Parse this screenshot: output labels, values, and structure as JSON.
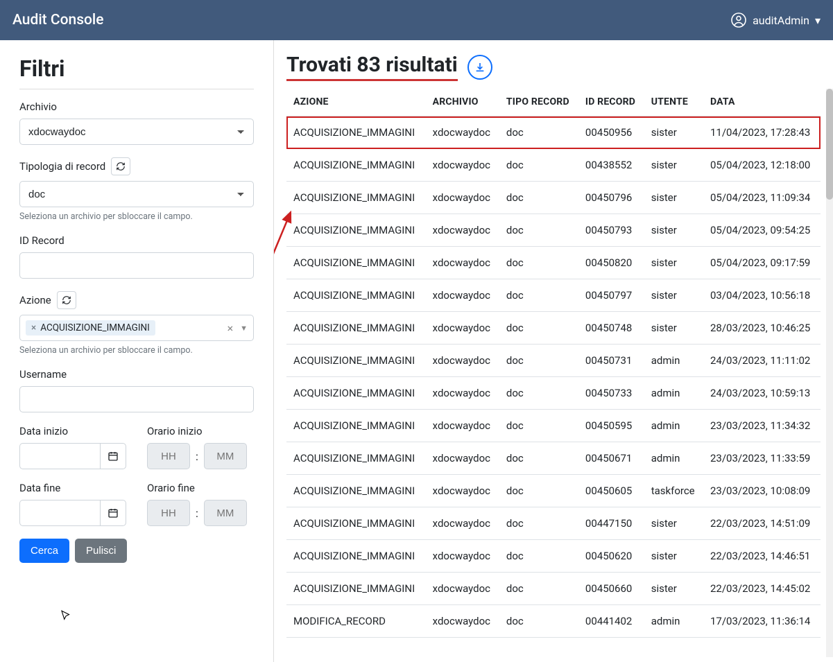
{
  "header": {
    "title": "Audit Console",
    "user": "auditAdmin"
  },
  "filters": {
    "heading": "Filtri",
    "archivio_label": "Archivio",
    "archivio_value": "xdocwaydoc",
    "tipologia_label": "Tipologia di record",
    "tipologia_value": "doc",
    "tipologia_help": "Seleziona un archivio per sbloccare il campo.",
    "id_record_label": "ID Record",
    "azione_label": "Azione",
    "azione_tag": "ACQUISIZIONE_IMMAGINI",
    "azione_help": "Seleziona un archivio per sbloccare il campo.",
    "username_label": "Username",
    "data_inizio_label": "Data inizio",
    "orario_inizio_label": "Orario inizio",
    "data_fine_label": "Data fine",
    "orario_fine_label": "Orario fine",
    "hh_placeholder": "HH",
    "mm_placeholder": "MM",
    "cerca_label": "Cerca",
    "pulisci_label": "Pulisci"
  },
  "results": {
    "heading": "Trovati 83 risultati",
    "columns": {
      "azione": "AZIONE",
      "archivio": "ARCHIVIO",
      "tipo": "TIPO RECORD",
      "id": "ID RECORD",
      "utente": "UTENTE",
      "data": "DATA"
    },
    "rows": [
      {
        "azione": "ACQUISIZIONE_IMMAGINI",
        "archivio": "xdocwaydoc",
        "tipo": "doc",
        "id": "00450956",
        "utente": "sister",
        "data": "11/04/2023, 17:28:43",
        "hl": true
      },
      {
        "azione": "ACQUISIZIONE_IMMAGINI",
        "archivio": "xdocwaydoc",
        "tipo": "doc",
        "id": "00438552",
        "utente": "sister",
        "data": "05/04/2023, 12:18:00"
      },
      {
        "azione": "ACQUISIZIONE_IMMAGINI",
        "archivio": "xdocwaydoc",
        "tipo": "doc",
        "id": "00450796",
        "utente": "sister",
        "data": "05/04/2023, 11:09:34"
      },
      {
        "azione": "ACQUISIZIONE_IMMAGINI",
        "archivio": "xdocwaydoc",
        "tipo": "doc",
        "id": "00450793",
        "utente": "sister",
        "data": "05/04/2023, 09:54:25"
      },
      {
        "azione": "ACQUISIZIONE_IMMAGINI",
        "archivio": "xdocwaydoc",
        "tipo": "doc",
        "id": "00450820",
        "utente": "sister",
        "data": "05/04/2023, 09:17:59"
      },
      {
        "azione": "ACQUISIZIONE_IMMAGINI",
        "archivio": "xdocwaydoc",
        "tipo": "doc",
        "id": "00450797",
        "utente": "sister",
        "data": "03/04/2023, 10:56:18"
      },
      {
        "azione": "ACQUISIZIONE_IMMAGINI",
        "archivio": "xdocwaydoc",
        "tipo": "doc",
        "id": "00450748",
        "utente": "sister",
        "data": "28/03/2023, 10:46:25"
      },
      {
        "azione": "ACQUISIZIONE_IMMAGINI",
        "archivio": "xdocwaydoc",
        "tipo": "doc",
        "id": "00450731",
        "utente": "admin",
        "data": "24/03/2023, 11:11:02"
      },
      {
        "azione": "ACQUISIZIONE_IMMAGINI",
        "archivio": "xdocwaydoc",
        "tipo": "doc",
        "id": "00450733",
        "utente": "admin",
        "data": "24/03/2023, 10:59:13"
      },
      {
        "azione": "ACQUISIZIONE_IMMAGINI",
        "archivio": "xdocwaydoc",
        "tipo": "doc",
        "id": "00450595",
        "utente": "admin",
        "data": "23/03/2023, 11:34:32"
      },
      {
        "azione": "ACQUISIZIONE_IMMAGINI",
        "archivio": "xdocwaydoc",
        "tipo": "doc",
        "id": "00450671",
        "utente": "admin",
        "data": "23/03/2023, 11:33:59"
      },
      {
        "azione": "ACQUISIZIONE_IMMAGINI",
        "archivio": "xdocwaydoc",
        "tipo": "doc",
        "id": "00450605",
        "utente": "taskforce",
        "data": "23/03/2023, 10:08:09"
      },
      {
        "azione": "ACQUISIZIONE_IMMAGINI",
        "archivio": "xdocwaydoc",
        "tipo": "doc",
        "id": "00447150",
        "utente": "sister",
        "data": "22/03/2023, 14:51:09"
      },
      {
        "azione": "ACQUISIZIONE_IMMAGINI",
        "archivio": "xdocwaydoc",
        "tipo": "doc",
        "id": "00450620",
        "utente": "sister",
        "data": "22/03/2023, 14:46:51"
      },
      {
        "azione": "ACQUISIZIONE_IMMAGINI",
        "archivio": "xdocwaydoc",
        "tipo": "doc",
        "id": "00450660",
        "utente": "sister",
        "data": "22/03/2023, 14:45:02"
      },
      {
        "azione": "MODIFICA_RECORD",
        "archivio": "xdocwaydoc",
        "tipo": "doc",
        "id": "00441402",
        "utente": "admin",
        "data": "17/03/2023, 11:36:14"
      }
    ]
  }
}
